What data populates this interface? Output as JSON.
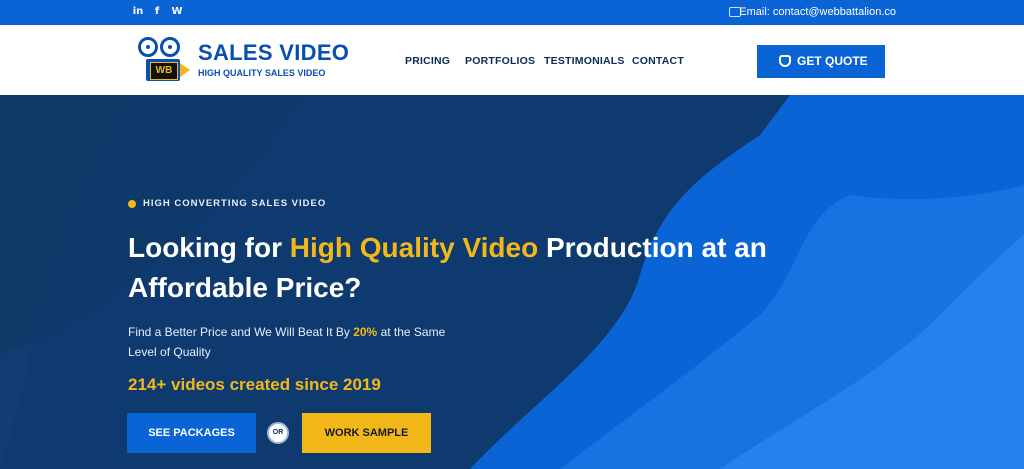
{
  "topbar": {
    "social_icons": [
      "linkedin-icon",
      "facebook-icon",
      "wordpress-icon"
    ],
    "email_label": "Email: contact@webbattalion.co",
    "email_icon": "mail-icon"
  },
  "logo": {
    "brand": "SALES VIDEO",
    "tagline": "HIGH QUALITY SALES VIDEO",
    "badge": "WB"
  },
  "nav": {
    "items": [
      "PRICING",
      "PORTFOLIOS",
      "TESTIMONIALS",
      "CONTACT"
    ]
  },
  "cta": {
    "quote_label": "GET QUOTE",
    "quote_icon": "coffee-cup-icon"
  },
  "hero": {
    "eyebrow": "HIGH CONVERTING SALES VIDEO",
    "title_pre": "Looking for ",
    "title_highlight": "High Quality Video",
    "title_post": " Production at an Affordable Price?",
    "subtitle_pre": "Find a Better Price and We Will Beat It By ",
    "subtitle_highlight": "20%",
    "subtitle_post": " at the Same Level of Quality",
    "stat": "214+ videos created since 2019",
    "btn_packages": "SEE PACKAGES",
    "or_label": "OR",
    "btn_sample": "WORK SAMPLE"
  },
  "colors": {
    "primary": "#0a64d6",
    "accent": "#f2b81a",
    "dark": "#0e3a6f"
  }
}
